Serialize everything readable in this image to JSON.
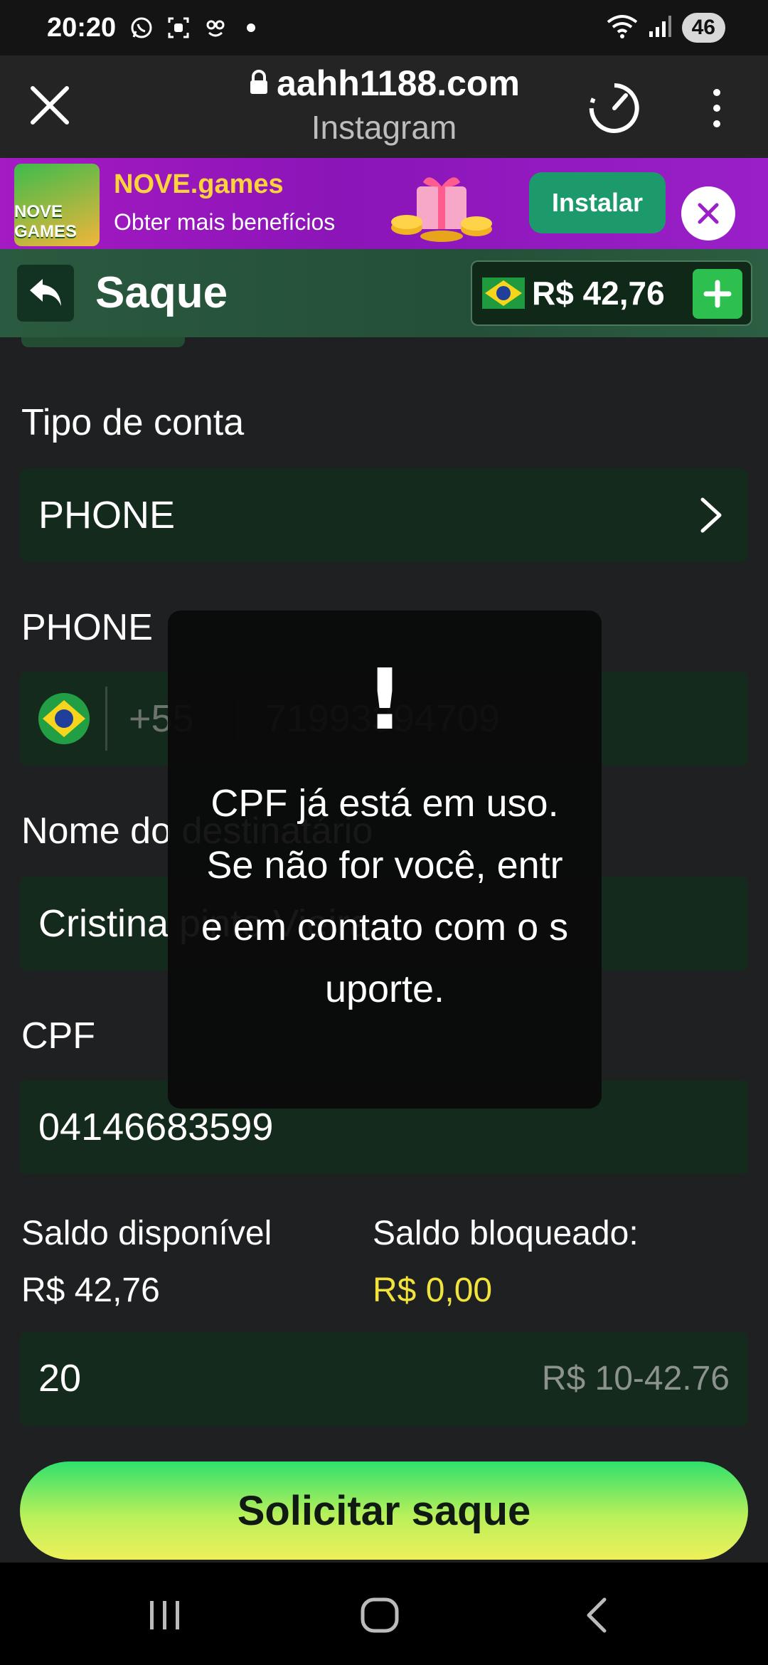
{
  "status_bar": {
    "time": "20:20",
    "battery": "46",
    "icons": [
      "whatsapp-icon",
      "screen-record-icon",
      "assistant-icon",
      "dot-icon",
      "wifi-icon",
      "signal-icon"
    ]
  },
  "browser": {
    "url": "aahh1188.com",
    "source": "Instagram",
    "icons": [
      "close-icon",
      "lock-icon",
      "timer-icon",
      "more-vert-icon"
    ]
  },
  "promo": {
    "logo_text": "NOVE GAMES",
    "title": "NOVE.games",
    "subtitle": "Obter mais benefícios",
    "install_label": "Instalar"
  },
  "header": {
    "title": "Saque",
    "balance": "R$ 42,76"
  },
  "form": {
    "account_type_label": "Tipo de conta",
    "account_type_value": "PHONE",
    "phone_label": "PHONE",
    "phone_country_code": "+55",
    "phone_number": "71993394709",
    "recipient_label": "Nome do destinatário",
    "recipient_value": "Cristina pinto Vieira",
    "cpf_label": "CPF",
    "cpf_value": "04146683599",
    "available_label": "Saldo disponível",
    "available_value": "R$ 42,76",
    "blocked_label": "Saldo bloqueado:",
    "blocked_value": "R$ 0,00",
    "amount_value": "20",
    "amount_range": "R$ 10-42.76",
    "submit_label": "Solicitar saque"
  },
  "toast": {
    "icon": "!",
    "message": "CPF já está em uso. Se não for você, entre em contato com o suporte."
  },
  "colors": {
    "background": "#1f2021",
    "field": "#142a1d",
    "header": "#2a5a3f",
    "promo": "#9a1fc8",
    "accent_green": "#2ec04e",
    "blocked_yellow": "#f1e33a"
  }
}
